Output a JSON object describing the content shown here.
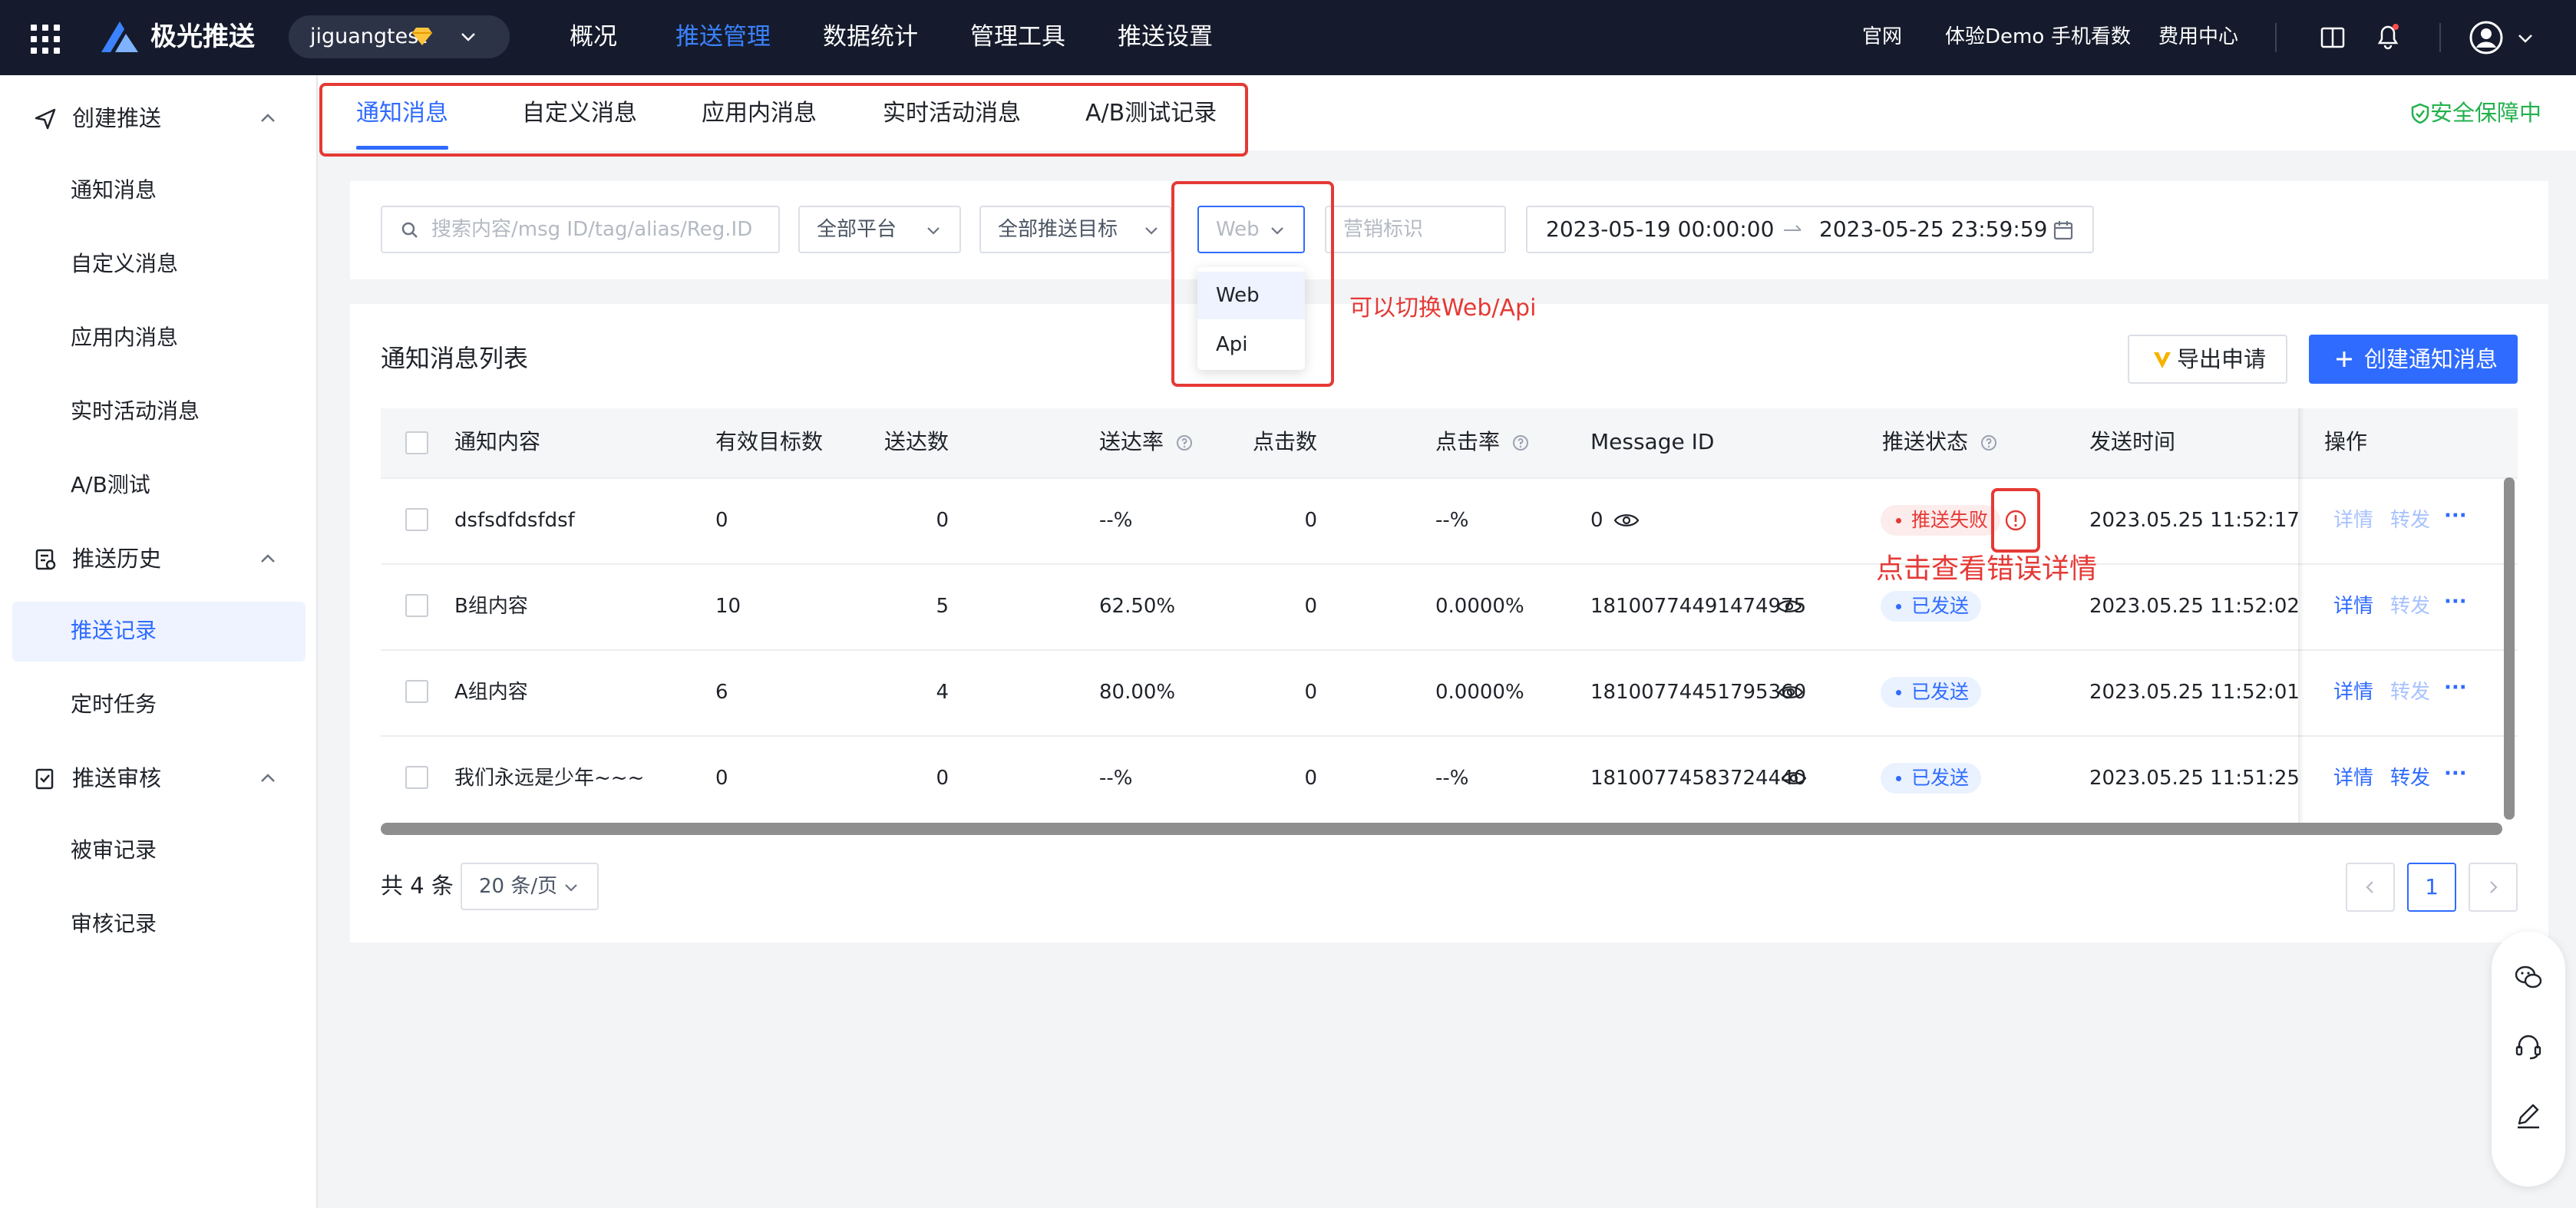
{
  "topbar": {
    "brand": "极光推送",
    "app_name": "jiguangtest",
    "nav": [
      "概况",
      "推送管理",
      "数据统计",
      "管理工具",
      "推送设置"
    ],
    "active_nav": "推送管理",
    "links": [
      "官网",
      "体验Demo",
      "手机看数",
      "费用中心"
    ]
  },
  "sidebar": {
    "groups": [
      {
        "label": "创建推送",
        "items": [
          "通知消息",
          "自定义消息",
          "应用内消息",
          "实时活动消息",
          "A/B测试"
        ]
      },
      {
        "label": "推送历史",
        "items": [
          "推送记录",
          "定时任务"
        ]
      },
      {
        "label": "推送审核",
        "items": [
          "被审记录",
          "审核记录"
        ]
      }
    ],
    "active_item": "推送记录"
  },
  "tabs": [
    "通知消息",
    "自定义消息",
    "应用内消息",
    "实时活动消息",
    "A/B测试记录"
  ],
  "security_label": "安全保障中",
  "filters": {
    "search_placeholder": "搜索内容/msg ID/tag/alias/Reg.ID",
    "platform": "全部平台",
    "target": "全部推送目标",
    "source": "Web",
    "marketing_placeholder": "营销标识",
    "date_start": "2023-05-19 00:00:00",
    "date_end": "2023-05-25 23:59:59",
    "source_options": [
      "Web",
      "Api"
    ]
  },
  "annotations": {
    "switch_hint": "可以切换Web/Api",
    "error_hint": "点击查看错误详情"
  },
  "list": {
    "title": "通知消息列表",
    "export_label": "导出申请",
    "create_label": "创建通知消息",
    "columns": [
      "通知内容",
      "有效目标数",
      "送达数",
      "送达率",
      "点击数",
      "点击率",
      "Message ID",
      "推送状态",
      "发送时间",
      "操作"
    ],
    "rows": [
      {
        "content": "dsfsdfdsfdsf",
        "targets": "0",
        "delivered": "0",
        "rate": "--%",
        "clicks": "0",
        "ctr": "--%",
        "msg_id": "0",
        "status": "推送失败",
        "time": "2023.05.25 11:52:17",
        "ops": [
          "详情",
          "转发"
        ]
      },
      {
        "content": "B组内容",
        "targets": "10",
        "delivered": "5",
        "rate": "62.50%",
        "clicks": "0",
        "ctr": "0.0000%",
        "msg_id": "18100774491474975",
        "status": "已发送",
        "time": "2023.05.25 11:52:02",
        "ops": [
          "详情",
          "转发"
        ]
      },
      {
        "content": "A组内容",
        "targets": "6",
        "delivered": "4",
        "rate": "80.00%",
        "clicks": "0",
        "ctr": "0.0000%",
        "msg_id": "18100774451795360",
        "status": "已发送",
        "time": "2023.05.25 11:52:01",
        "ops": [
          "详情",
          "转发"
        ]
      },
      {
        "content": "我们永远是少年~~~",
        "targets": "0",
        "delivered": "0",
        "rate": "--%",
        "clicks": "0",
        "ctr": "--%",
        "msg_id": "18100774583724440",
        "status": "已发送",
        "time": "2023.05.25 11:51:25",
        "ops": [
          "详情",
          "转发"
        ]
      }
    ],
    "more_label": "···",
    "total_label": "共 4 条",
    "page_size": "20 条/页",
    "current_page": "1"
  },
  "colors": {
    "accent": "#2f6bff",
    "topbar": "#151b2c",
    "fail": "#e53935",
    "annotation": "#e53935",
    "safe": "#23b14d"
  }
}
